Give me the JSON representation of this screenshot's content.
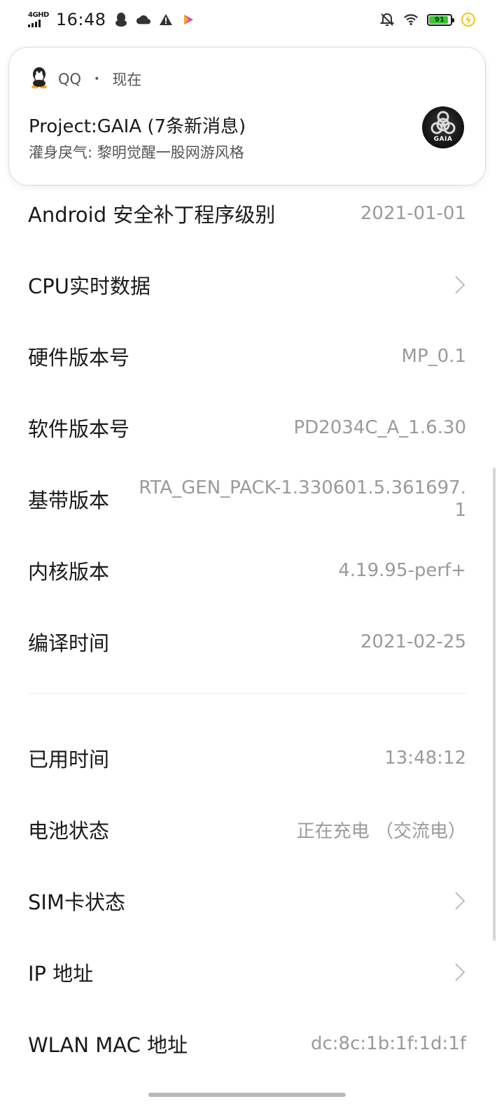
{
  "status_bar": {
    "network_label": "4GHD",
    "time": "16:48",
    "battery_level": "91",
    "battery_fraction": 0.91,
    "icons_left": [
      "qq-icon",
      "cloud-icon",
      "warning-icon",
      "video-app-icon"
    ],
    "icons_right": [
      "bell-off-icon",
      "wifi-icon",
      "battery-icon",
      "charging-icon"
    ]
  },
  "notification": {
    "app": "QQ",
    "dot": "•",
    "time": "现在",
    "title": "Project:GAIA (7条新消息)",
    "body": "灌身戾气: 黎明觉醒一股网游风格",
    "avatar_text": "GAIA"
  },
  "rows": [
    {
      "label": "Android 安全补丁程序级别",
      "value": "2021-01-01",
      "chevron": false
    },
    {
      "label": "CPU实时数据",
      "value": "",
      "chevron": true
    },
    {
      "label": "硬件版本号",
      "value": "MP_0.1",
      "chevron": false
    },
    {
      "label": "软件版本号",
      "value": "PD2034C_A_1.6.30",
      "chevron": false
    },
    {
      "label": "基带版本",
      "value": "RTA_GEN_PACK-1.330601.5.361697.1",
      "chevron": false
    },
    {
      "label": "内核版本",
      "value": "4.19.95-perf+",
      "chevron": false
    },
    {
      "label": "编译时间",
      "value": "2021-02-25",
      "chevron": false
    }
  ],
  "rows2": [
    {
      "label": "已用时间",
      "value": "13:48:12",
      "chevron": false
    },
    {
      "label": "电池状态",
      "value": "正在充电 （交流电）",
      "chevron": false
    },
    {
      "label": "SIM卡状态",
      "value": "",
      "chevron": true
    },
    {
      "label": "IP 地址",
      "value": "",
      "chevron": true
    },
    {
      "label": "WLAN MAC 地址",
      "value": "dc:8c:1b:1f:1d:1f",
      "chevron": false
    }
  ],
  "colors": {
    "battery_fill": "#37c837",
    "charging": "#f5c518",
    "value_text": "#9a9a9a"
  }
}
